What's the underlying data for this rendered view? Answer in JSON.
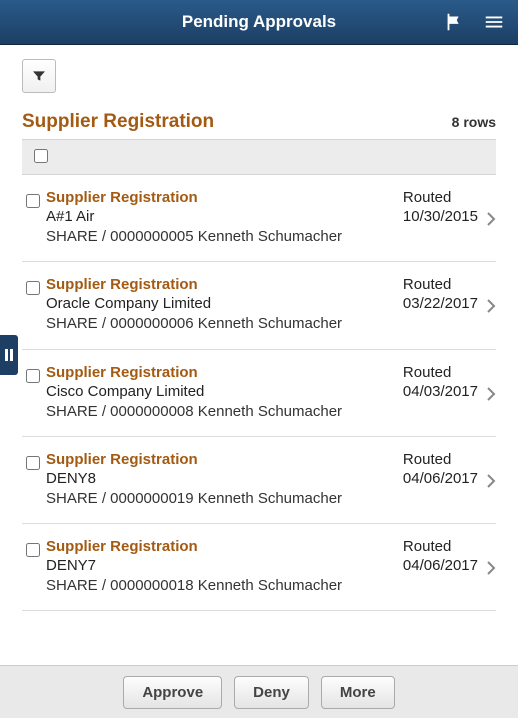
{
  "header": {
    "title": "Pending Approvals"
  },
  "section": {
    "title": "Supplier Registration",
    "rows_label": "8 rows"
  },
  "rows": [
    {
      "type": "Supplier Registration",
      "name": "A#1 Air",
      "submitter": "SHARE / 0000000005  Kenneth Schumacher",
      "status": "Routed",
      "date": "10/30/2015"
    },
    {
      "type": "Supplier Registration",
      "name": "Oracle Company Limited",
      "submitter": "SHARE / 0000000006  Kenneth Schumacher",
      "status": "Routed",
      "date": "03/22/2017"
    },
    {
      "type": "Supplier Registration",
      "name": "Cisco Company Limited",
      "submitter": "SHARE / 0000000008  Kenneth Schumacher",
      "status": "Routed",
      "date": "04/03/2017"
    },
    {
      "type": "Supplier Registration",
      "name": "DENY8",
      "submitter": "SHARE / 0000000019  Kenneth Schumacher",
      "status": "Routed",
      "date": "04/06/2017"
    },
    {
      "type": "Supplier Registration",
      "name": "DENY7",
      "submitter": "SHARE / 0000000018  Kenneth Schumacher",
      "status": "Routed",
      "date": "04/06/2017"
    }
  ],
  "footer": {
    "approve": "Approve",
    "deny": "Deny",
    "more": "More"
  }
}
